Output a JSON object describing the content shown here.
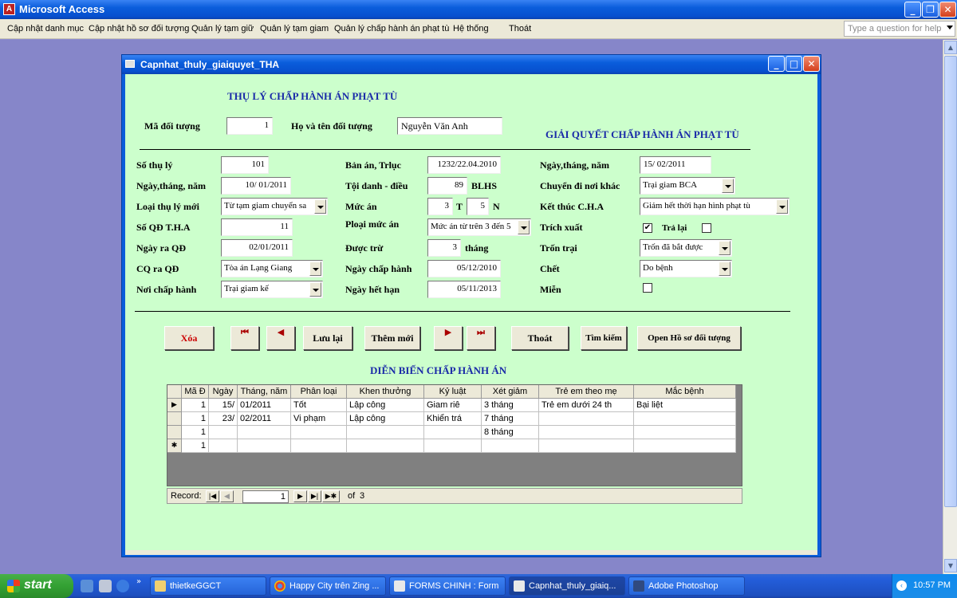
{
  "app": {
    "title": "Microsoft Access",
    "help_placeholder": "Type a question for help"
  },
  "menu": [
    "Cập nhật danh mục",
    "Cập nhật hồ sơ đối tượng",
    "Quản lý tạm giữ",
    "Quản lý tạm giam",
    "Quản lý chấp hành án phạt tù",
    "Hệ thống",
    "Thoát"
  ],
  "form": {
    "title": "Capnhat_thuly_giaiquyet_THA",
    "header_left": "THỤ LÝ CHẤP HÀNH ÁN PHẠT TÙ",
    "header_right": "GIẢI QUYẾT CHẤP HÀNH ÁN PHẠT TÙ",
    "ma_doi_tuong_label": "Mã đối tượng",
    "ma_doi_tuong": "1",
    "ho_ten_label": "Họ và tên đối tượng",
    "ho_ten": "Nguyễn Văn Anh",
    "col1": {
      "so_thu_ly_label": "Số thụ lý",
      "so_thu_ly": "101",
      "ngay_label": "Ngày,tháng, năm",
      "ngay": "10/ 01/2011",
      "loai_thu_ly_label": "Loại thụ lý mới",
      "loai_thu_ly": "Từ tạm giam chuyển sa",
      "so_qd_label": "Số QĐ T.H.A",
      "so_qd": "11",
      "ngay_ra_qd_label": "Ngày ra QĐ",
      "ngay_ra_qd": "02/01/2011",
      "cq_ra_qd_label": "CQ ra QĐ",
      "cq_ra_qd": "Tòa án Lạng Giang",
      "noi_chap_hanh_label": "Nơi chấp hành",
      "noi_chap_hanh": "Trại giam kế"
    },
    "col2": {
      "ban_an_label": "Bản án, Trlục",
      "ban_an": "1232/22.04.2010",
      "toi_danh_label": "Tội danh - điều",
      "toi_danh": "89",
      "blhs": "BLHS",
      "muc_an_label": "Mức án",
      "muc_an_t": "3",
      "t_label": "T",
      "muc_an_n": "5",
      "n_label": "N",
      "ploai_label": "Ploại mức án",
      "ploai": "Mức án từ trên 3 đến 5",
      "duoc_tru_label": "Được trừ",
      "duoc_tru": "3",
      "thang_label": "tháng",
      "ngay_chap_hanh_label": "Ngày chấp hành",
      "ngay_chap_hanh": "05/12/2010",
      "ngay_het_han_label": "Ngày hết hạn",
      "ngay_het_han": "05/11/2013"
    },
    "col3": {
      "ngay_label": "Ngày,tháng, năm",
      "ngay": "15/ 02/2011",
      "chuyen_label": "Chuyển đi nơi khác",
      "chuyen": "Trại giam BCA",
      "ket_thuc_label": "Kết thúc C.H.A",
      "ket_thuc": "Giảm hết thời hạn hình phạt tù",
      "trich_xuat_label": "Trích xuất",
      "trich_xuat_checked": "✔",
      "tra_lai_label": "Trả lại",
      "tron_trai_label": "Trốn trại",
      "tron_trai": "Trốn đã bắt được",
      "chet_label": "Chết",
      "chet": "Do bệnh",
      "mien_label": "Miễn"
    },
    "buttons": {
      "xoa": "Xóa",
      "first": "⏮",
      "prev": "◀",
      "luu_lai": "Lưu lại",
      "them_moi": "Thêm mới",
      "next": "▶",
      "last": "⏭",
      "thoat": "Thoát",
      "tim_kiem": "Tìm kiếm",
      "open_hs": "Open Hồ sơ đối tượng"
    },
    "subform_title": "DIỄN BIẾN CHẤP HÀNH ÁN",
    "grid": {
      "headers": [
        "Mã Đ",
        "Ngày",
        "Tháng, năm",
        "Phân loại",
        "Khen thưởng",
        "Kỷ luật",
        "Xét giảm",
        "Trẻ em theo mẹ",
        "Mắc bệnh"
      ],
      "rows": [
        [
          "1",
          "15/",
          "01/2011",
          "Tốt",
          "Lập công",
          "Giam riê",
          "3 tháng",
          "Trẻ em dưới 24 th",
          "Bại liệt"
        ],
        [
          "1",
          "23/",
          "02/2011",
          "Vi phạm",
          "Lập công",
          "Khiển trá",
          "7 tháng",
          "",
          ""
        ],
        [
          "1",
          "",
          "",
          "",
          "",
          "",
          "8 tháng",
          "",
          ""
        ],
        [
          "1",
          "",
          "",
          "",
          "",
          "",
          "",
          "",
          ""
        ]
      ],
      "record_label": "Record:",
      "record_current": "1",
      "record_of": "of",
      "record_total": "3"
    }
  },
  "taskbar": {
    "start": "start",
    "tasks": [
      "thietkeGGCT",
      "Happy City trên Zing ...",
      "FORMS CHINH : Form",
      "Capnhat_thuly_giaiq...",
      "Adobe Photoshop"
    ],
    "clock": "10:57 PM"
  }
}
